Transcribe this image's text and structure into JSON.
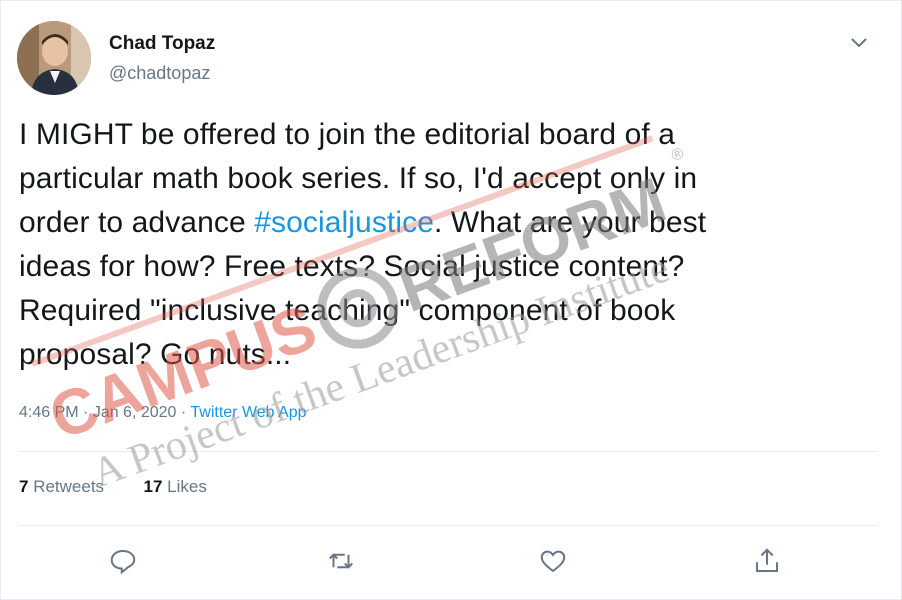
{
  "tweet": {
    "author_name": "Chad Topaz",
    "author_handle": "@chadtopaz",
    "text_parts": {
      "line1": "I MIGHT be offered to join the editorial board of a",
      "line2": "particular math book series. If so, I'd accept only in",
      "line3_pre": "order to advance ",
      "hashtag": "#socialjustice",
      "line3_post": ". What are your best",
      "line4": "ideas for how? Free texts? Social justice content?",
      "line5": "Required \"inclusive teaching\" component of book",
      "line6": "proposal? Go nuts..."
    },
    "time": "4:46 PM",
    "date": "Jan 6, 2020",
    "separator": " · ",
    "source_app": "Twitter Web App",
    "retweets_count": "7",
    "retweets_label": " Retweets",
    "likes_count": "17",
    "likes_label": " Likes"
  },
  "icons": {
    "more": "chevron-down-icon",
    "reply": "reply-icon",
    "retweet": "retweet-icon",
    "like": "heart-icon",
    "share": "share-icon"
  },
  "watermark": {
    "brand_left": "CAMPUS",
    "brand_right": "REFORM",
    "tagline": "A Project of the Leadership Institute",
    "registered": "®"
  },
  "colors": {
    "link": "#1b95e0",
    "muted": "#657786",
    "text": "#14171a",
    "watermark_red": "#e05a4a",
    "watermark_grey": "#8a8a8a"
  }
}
